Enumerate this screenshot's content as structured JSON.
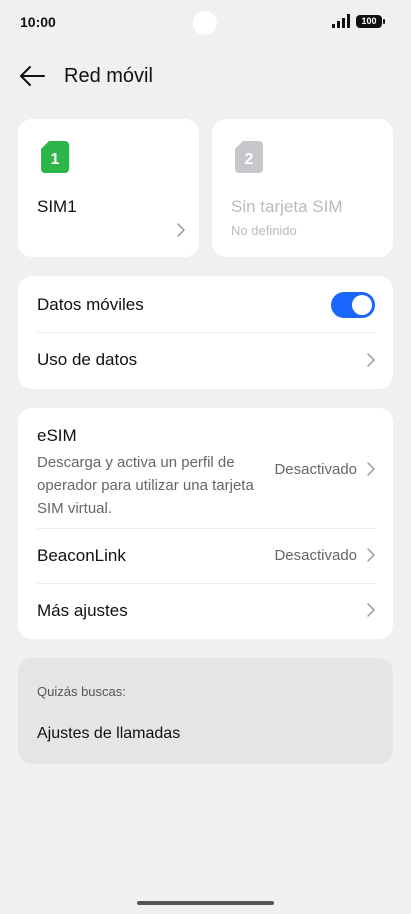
{
  "status": {
    "time": "10:00",
    "battery": "100"
  },
  "header": {
    "title": "Red móvil"
  },
  "sim_cards": [
    {
      "number": "1",
      "label": "SIM1",
      "color": "#2cb64a"
    },
    {
      "number": "2",
      "label": "Sin tarjeta SIM",
      "sublabel": "No definido",
      "color": "#c5c7ca"
    }
  ],
  "mobile": {
    "data_label": "Datos móviles",
    "data_on": true,
    "usage_label": "Uso de datos"
  },
  "esim": {
    "title": "eSIM",
    "description": "Descarga y activa un perfil de operador para utilizar una tarjeta SIM virtual.",
    "status": "Desactivado"
  },
  "beaconlink": {
    "label": "BeaconLink",
    "status": "Desactivado"
  },
  "more_settings": {
    "label": "Más ajustes"
  },
  "suggestions": {
    "title": "Quizás buscas:",
    "items": [
      "Ajustes de llamadas"
    ]
  },
  "colors": {
    "accent": "#1a66ff",
    "background": "#eff0f2"
  }
}
